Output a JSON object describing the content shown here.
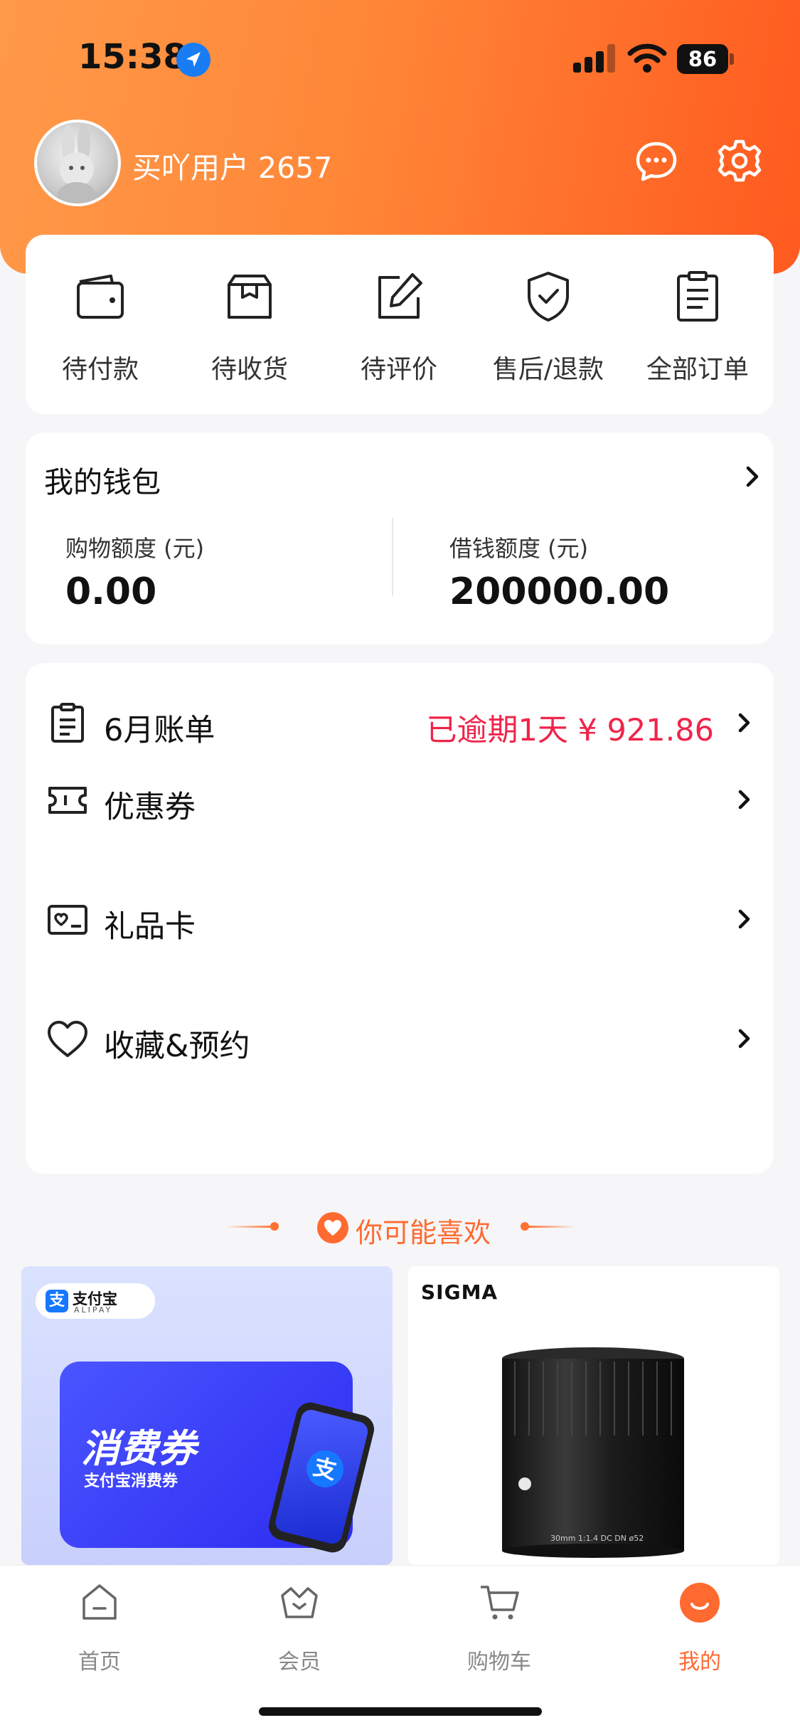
{
  "status_bar": {
    "time": "15:38",
    "battery": "86"
  },
  "profile": {
    "username": "买吖用户 2657"
  },
  "orders": [
    {
      "label": "待付款",
      "icon": "wallet-icon"
    },
    {
      "label": "待收货",
      "icon": "package-icon"
    },
    {
      "label": "待评价",
      "icon": "edit-icon"
    },
    {
      "label": "售后/退款",
      "icon": "shield-check-icon"
    },
    {
      "label": "全部订单",
      "icon": "clipboard-icon"
    }
  ],
  "wallet": {
    "title": "我的钱包",
    "shopping_label": "购物额度 (元)",
    "shopping_value": "0.00",
    "loan_label": "借钱额度 (元)",
    "loan_value": "200000.00"
  },
  "menu": {
    "bill_label": "6月账单",
    "bill_status": "已逾期1天 ¥ 921.86",
    "coupon_label": "优惠券",
    "giftcard_label": "礼品卡",
    "favorites_label": "收藏&预约"
  },
  "recommend": {
    "title": "你可能喜欢"
  },
  "products": {
    "left": {
      "badge_name": "支付宝",
      "badge_en": "ALIPAY",
      "badge_glyph": "支",
      "coupon_title": "消费券",
      "coupon_sub": "支付宝消费券"
    },
    "right": {
      "brand": "SIGMA",
      "lens_text": "30mm 1:1.4 DC DN ø52"
    }
  },
  "tabbar": {
    "home": "首页",
    "member": "会员",
    "cart": "购物车",
    "mine": "我的"
  },
  "colors": {
    "accent": "#ff6a30",
    "overdue": "#f0244a",
    "header_gradient_start": "#ff9a4a",
    "header_gradient_end": "#ff5a1f"
  }
}
